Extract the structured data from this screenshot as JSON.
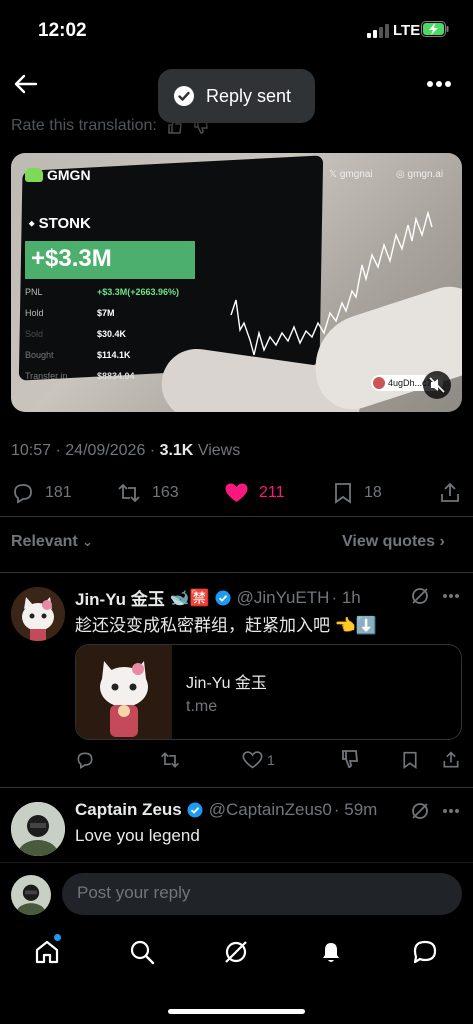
{
  "status": {
    "time": "12:02",
    "network": "LTE"
  },
  "toast": {
    "label": "Reply sent"
  },
  "translation": {
    "rate_label": "Rate this translation:"
  },
  "media": {
    "brand": "GMGN",
    "x_handle": "gmgnai",
    "site": "gmgn.ai",
    "token": "STONK",
    "pnl_big": "+$3.3M",
    "stats": [
      {
        "key": "PNL",
        "value": "+$3.3M(+2663.96%)"
      },
      {
        "key": "Hold",
        "value": "$7M"
      },
      {
        "key": "Sold",
        "value": "$30.4K"
      },
      {
        "key": "Bought",
        "value": "$114.1K"
      },
      {
        "key": "Transfer in",
        "value": "$8834.04"
      }
    ],
    "badge": "4ugDh...c7p"
  },
  "post": {
    "time": "10:57",
    "date": "24/09/2026",
    "views_count": "3.1K",
    "views_label": "Views",
    "replies": "181",
    "reposts": "163",
    "likes": "211",
    "bookmarks": "18"
  },
  "sort": {
    "label": "Relevant",
    "view_quotes": "View quotes"
  },
  "replies": [
    {
      "name": "Jin-Yu 金玉",
      "emoji": "🐋🈲",
      "handle": "@JinYuETH",
      "time": "1h",
      "text": "趁还没变成私密群组，赶紧加入吧 👈⬇️",
      "card_title": "Jin-Yu 金玉",
      "card_domain": "t.me",
      "likes": "1"
    },
    {
      "name": "Captain Zeus",
      "handle": "@CaptainZeus0",
      "time": "59m",
      "text": "Love you legend"
    }
  ],
  "compose": {
    "placeholder": "Post your reply"
  },
  "colors": {
    "accent": "#1d9bf0",
    "like": "#f91880",
    "pnl_green": "#4caf6e"
  }
}
